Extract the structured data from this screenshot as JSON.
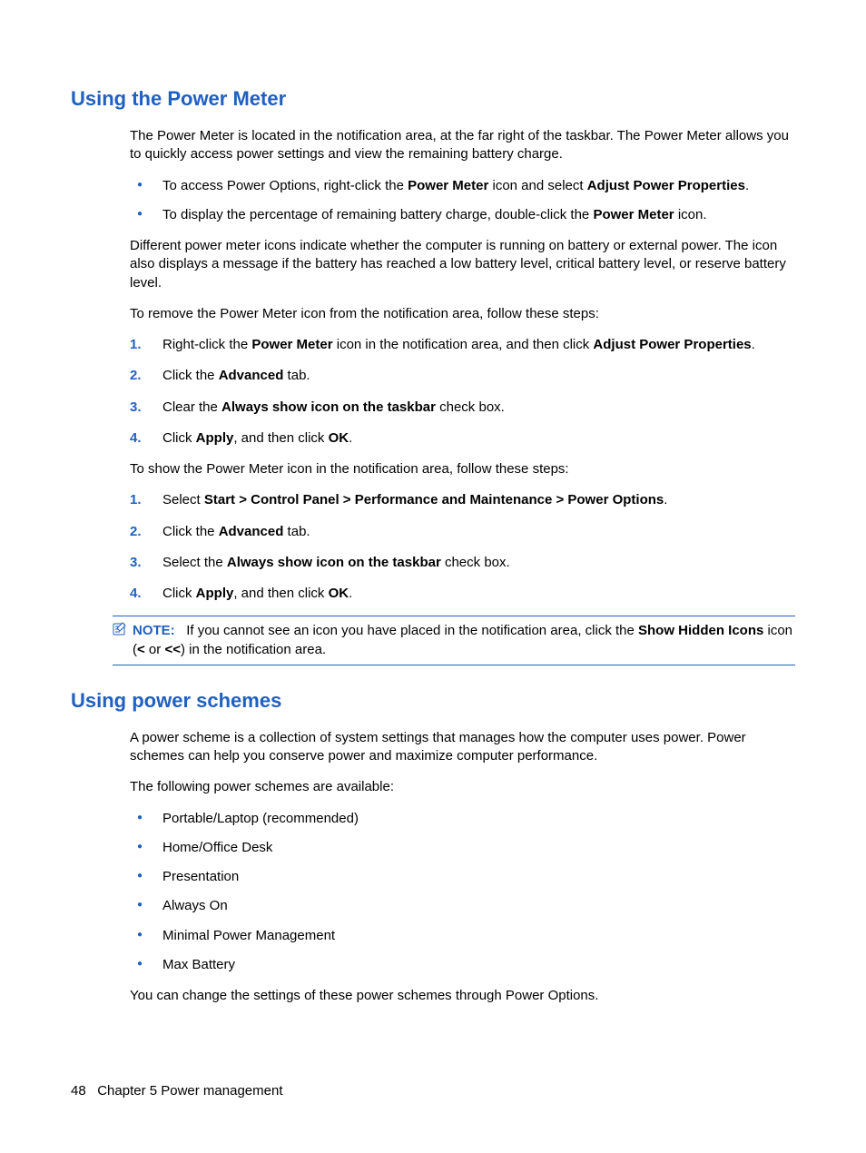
{
  "section1": {
    "heading": "Using the Power Meter",
    "intro": "The Power Meter is located in the notification area, at the far right of the taskbar. The Power Meter allows you to quickly access power settings and view the remaining battery charge.",
    "bullets": [
      {
        "pre": "To access Power Options, right-click the ",
        "b1": "Power Meter",
        "mid": " icon and select ",
        "b2": "Adjust Power Properties",
        "post": "."
      },
      {
        "pre": "To display the percentage of remaining battery charge, double-click the ",
        "b1": "Power Meter",
        "mid": "",
        "b2": "",
        "post": " icon."
      }
    ],
    "para2": "Different power meter icons indicate whether the computer is running on battery or external power. The icon also displays a message if the battery has reached a low battery level, critical battery level, or reserve battery level.",
    "para3": "To remove the Power Meter icon from the notification area, follow these steps:",
    "steps_remove": [
      {
        "pre": "Right-click the ",
        "b1": "Power Meter",
        "mid": " icon in the notification area, and then click ",
        "b2": "Adjust Power Properties",
        "post": "."
      },
      {
        "pre": "Click the ",
        "b1": "Advanced",
        "mid": "",
        "b2": "",
        "post": " tab."
      },
      {
        "pre": "Clear the ",
        "b1": "Always show icon on the taskbar",
        "mid": "",
        "b2": "",
        "post": " check box."
      },
      {
        "pre": "Click ",
        "b1": "Apply",
        "mid": ", and then click ",
        "b2": "OK",
        "post": "."
      }
    ],
    "para4": "To show the Power Meter icon in the notification area, follow these steps:",
    "steps_show": [
      {
        "pre": "Select ",
        "b1": "Start > Control Panel > Performance and Maintenance > Power Options",
        "mid": "",
        "b2": "",
        "post": "."
      },
      {
        "pre": "Click the ",
        "b1": "Advanced",
        "mid": "",
        "b2": "",
        "post": " tab."
      },
      {
        "pre": "Select the ",
        "b1": "Always show icon on the taskbar",
        "mid": "",
        "b2": "",
        "post": " check box."
      },
      {
        "pre": "Click ",
        "b1": "Apply",
        "mid": ", and then click ",
        "b2": "OK",
        "post": "."
      }
    ],
    "note": {
      "label": "NOTE:",
      "pre": "If you cannot see an icon you have placed in the notification area, click the ",
      "b1": "Show Hidden Icons",
      "mid": " icon (",
      "b2": "<",
      "mid2": " or ",
      "b3": "<<",
      "post": ") in the notification area."
    }
  },
  "section2": {
    "heading": "Using power schemes",
    "intro": "A power scheme is a collection of system settings that manages how the computer uses power. Power schemes can help you conserve power and maximize computer performance.",
    "para2": "The following power schemes are available:",
    "bullets": [
      "Portable/Laptop (recommended)",
      "Home/Office Desk",
      "Presentation",
      "Always On",
      "Minimal Power Management",
      "Max Battery"
    ],
    "para3": "You can change the settings of these power schemes through Power Options."
  },
  "footer": {
    "page": "48",
    "chapter": "Chapter 5   Power management"
  }
}
